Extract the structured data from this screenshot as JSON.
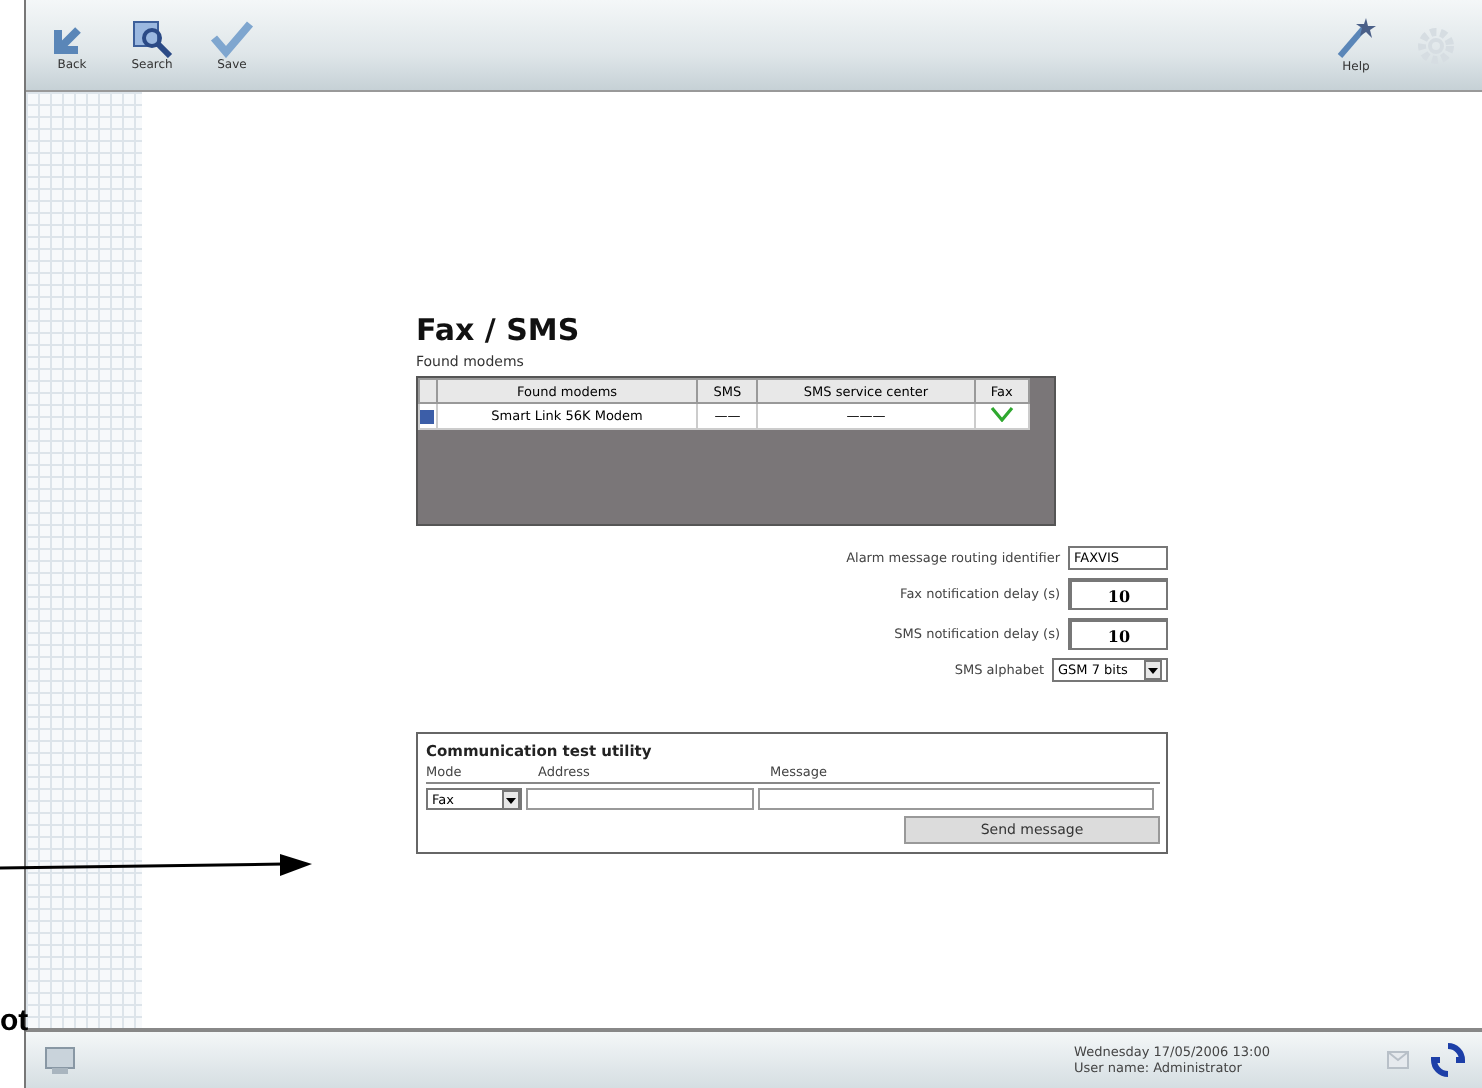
{
  "toolbar": {
    "left": [
      {
        "label": "Back",
        "kind": "back"
      },
      {
        "label": "Search",
        "kind": "search"
      },
      {
        "label": "Save",
        "kind": "save"
      }
    ],
    "right": [
      {
        "label": "Help",
        "kind": "help",
        "disabled": false
      },
      {
        "kind": "gear",
        "disabled": true
      }
    ]
  },
  "page": {
    "title": "Fax / SMS",
    "modems_label": "Found modems",
    "table": {
      "columns": [
        "Found modems",
        "SMS",
        "SMS service center",
        "Fax"
      ],
      "rows": [
        {
          "selected": true,
          "cells": [
            "Smart Link 56K Modem",
            "——",
            "———"
          ],
          "fax": true
        }
      ]
    },
    "settings": [
      {
        "kind": "text",
        "label": "Alarm message routing identifier",
        "value": "FAXVIS"
      },
      {
        "kind": "number",
        "label": "Fax notification delay (s)",
        "value": "10"
      },
      {
        "kind": "number",
        "label": "SMS notification delay (s)",
        "value": "10"
      },
      {
        "kind": "select",
        "label": "SMS alphabet",
        "value": "GSM 7 bits"
      }
    ],
    "test_utility": {
      "title": "Communication test utility",
      "mode_label": "Mode",
      "address_label": "Address",
      "message_label": "Message",
      "mode_value": "Fax",
      "send_button": "Send message"
    }
  },
  "status_bar": {
    "date_line": "Wednesday  17/05/2006   13:00",
    "user_line": "User name: Administrator"
  },
  "annotation": {
    "text": "ot"
  }
}
